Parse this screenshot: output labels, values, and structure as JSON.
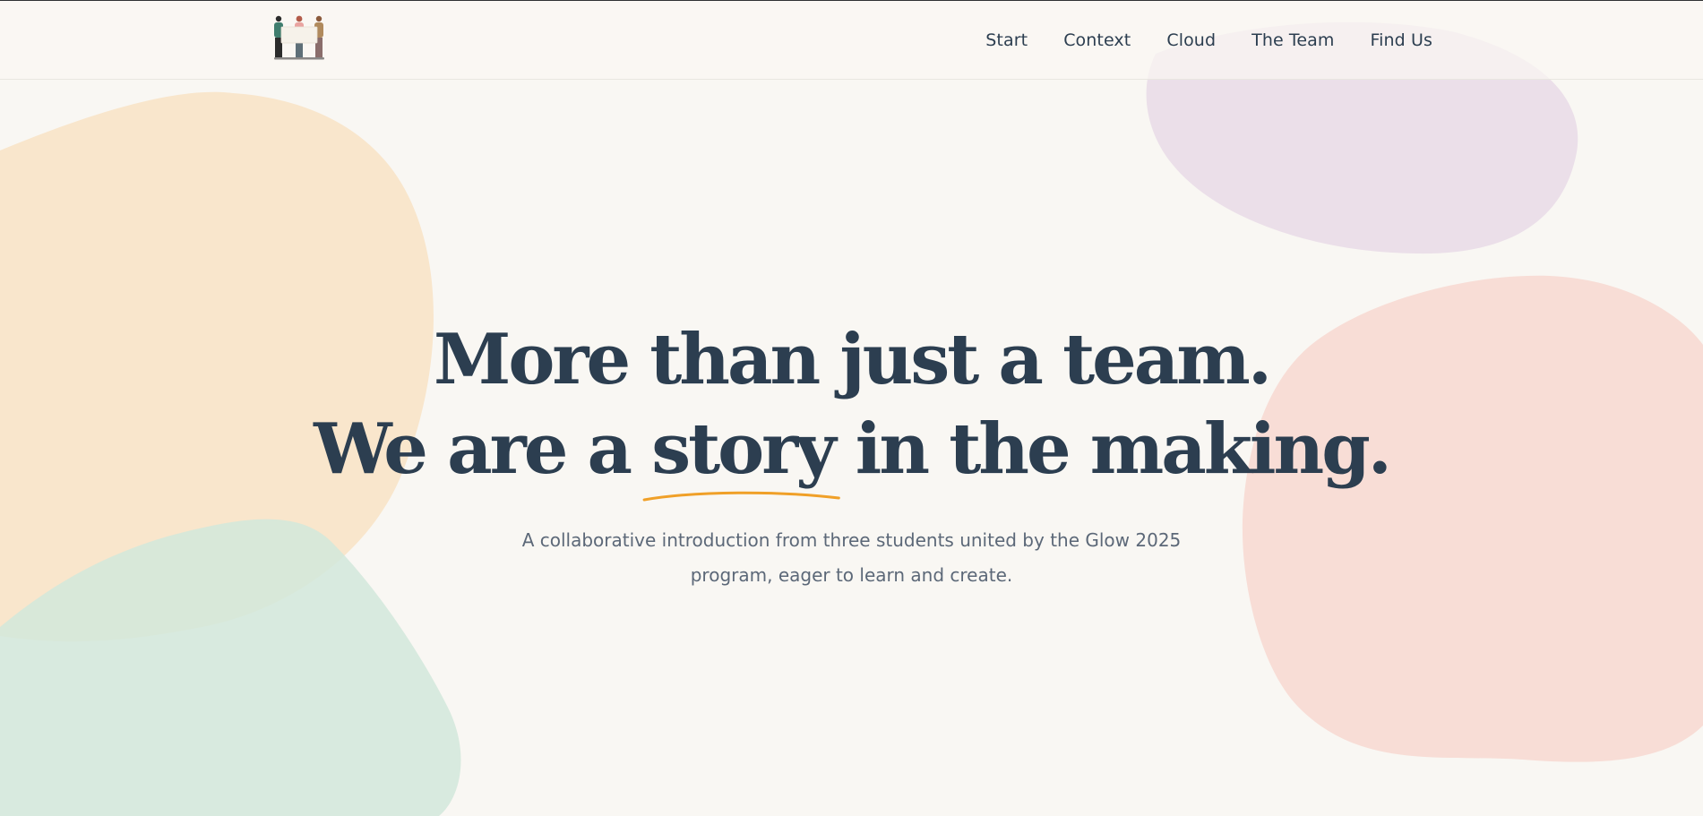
{
  "header": {
    "logo_alt": "Three students holding a sign",
    "nav": [
      {
        "label": "Start"
      },
      {
        "label": "Context"
      },
      {
        "label": "Cloud"
      },
      {
        "label": "The Team"
      },
      {
        "label": "Find Us"
      }
    ]
  },
  "hero": {
    "line1": "More than just a team.",
    "line2_before": "We are a ",
    "line2_highlight": "story",
    "line2_after": " in the making.",
    "subtitle": "A collaborative introduction from three students united by the Glow 2025 program, eager to learn and create."
  },
  "colors": {
    "background": "#f9f7f3",
    "text": "#2c3e50",
    "subtitle": "#5c6878",
    "underline_accent": "#f0a028",
    "blob_peach": "#f9e6cc",
    "blob_mint": "#d7ede3",
    "blob_lavender": "#ebdfe9",
    "blob_pink": "#f8ddd6"
  }
}
